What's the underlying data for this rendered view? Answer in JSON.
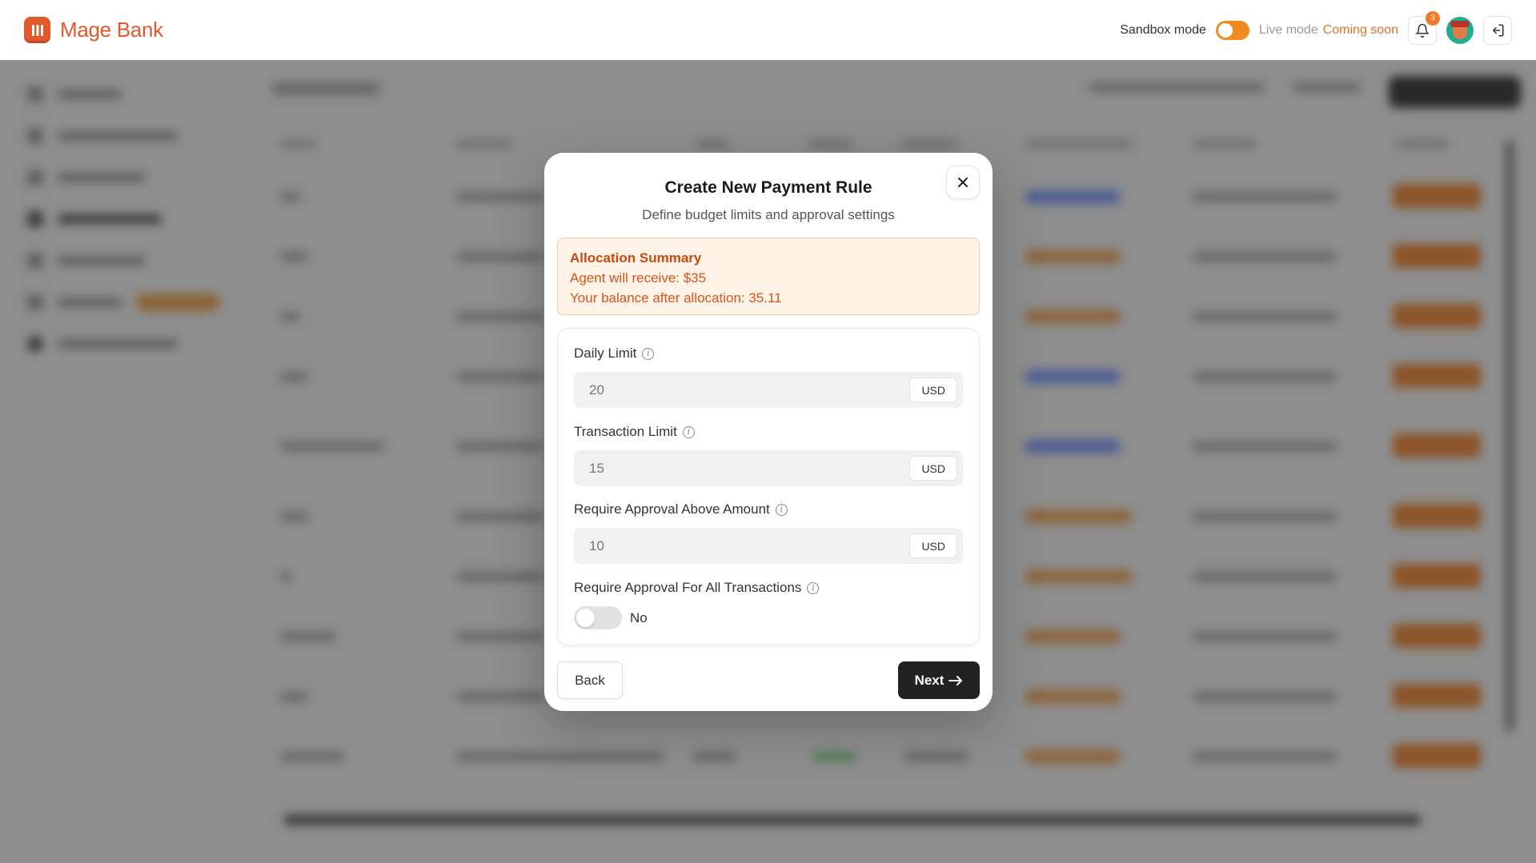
{
  "header": {
    "app_name": "Mage Bank",
    "sandbox_label": "Sandbox mode",
    "live_label": "Live mode",
    "coming_soon": "Coming soon",
    "notification_count": "3"
  },
  "modal": {
    "title": "Create New Payment Rule",
    "subtitle": "Define budget limits and approval settings",
    "summary": {
      "title": "Allocation Summary",
      "line1": "Agent will receive: $35",
      "line2": "Your balance after allocation: 35.11"
    },
    "fields": [
      {
        "label": "Daily Limit",
        "placeholder": "20",
        "unit": "USD"
      },
      {
        "label": "Transaction Limit",
        "placeholder": "15",
        "unit": "USD"
      },
      {
        "label": "Require Approval Above Amount",
        "placeholder": "10",
        "unit": "USD"
      }
    ],
    "approval_all": {
      "label": "Require Approval For All Transactions",
      "value": "No"
    },
    "back_label": "Back",
    "next_label": "Next"
  },
  "colors": {
    "brand": "#e2592d",
    "accent": "#f28a1f",
    "primary_button": "#222222"
  }
}
